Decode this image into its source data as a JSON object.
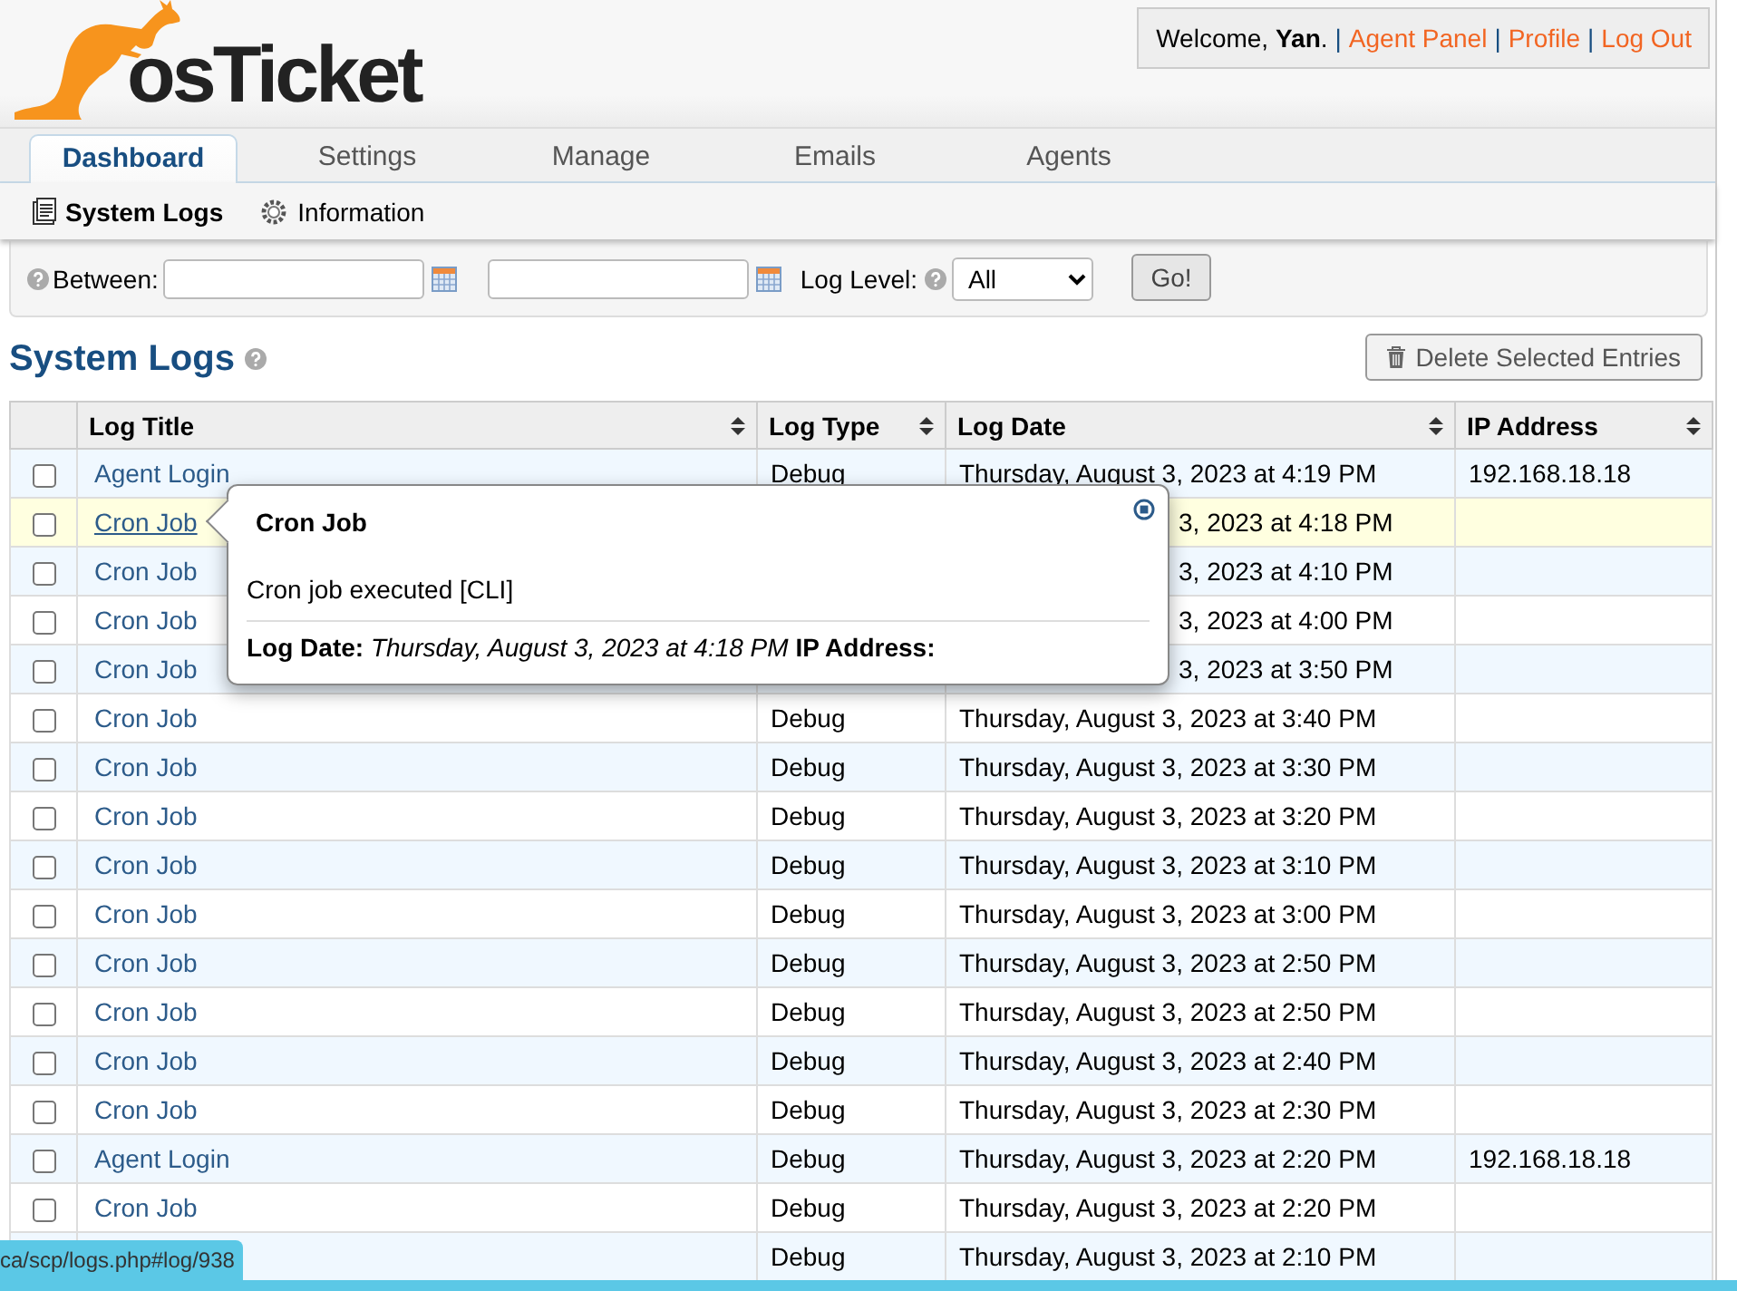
{
  "header": {
    "logo": "osTicket",
    "greeting": "Welcome, **Yan**.",
    "links": [
      {
        "label": "Agent Panel",
        "separator": "|"
      },
      {
        "label": "Profile",
        "separator": "|"
      },
      {
        "label": "Log Out",
        "separator": "|"
      }
    ]
  },
  "nav": {
    "tabs": [
      {
        "label": "Dashboard",
        "selected": true
      },
      {
        "label": "Settings",
        "selected": false
      },
      {
        "label": "Manage",
        "selected": false
      },
      {
        "label": "Emails",
        "selected": false
      },
      {
        "label": "Agents",
        "selected": false
      }
    ],
    "subtabs": [
      {
        "label": "System Logs",
        "kind": "logs",
        "selected": true
      },
      {
        "label": "Information",
        "kind": "info",
        "selected": false
      }
    ]
  },
  "filter": {
    "between_label": "Between:",
    "level_label": "Log Level:",
    "level_value": "All",
    "go_button": "Go!"
  },
  "page_title": "System Logs",
  "delete_button": "Delete Selected Entries",
  "table": {
    "columns": [
      "Log Title",
      "Log Type",
      "Log Date",
      "IP Address"
    ],
    "rows": [
      {
        "checked": false,
        "hovered": false,
        "title": "Agent Login",
        "type": "Debug",
        "date": "Thursday, August 3, 2023 at 4:19 PM",
        "ip": "192.168.18.18"
      },
      {
        "checked": false,
        "hovered": true,
        "title": "Cron Job",
        "date": "3, 2023 at 4:18 PM"
      },
      {
        "checked": false,
        "hovered": false,
        "title": "Cron Job",
        "date": "3, 2023 at 4:10 PM"
      },
      {
        "checked": false,
        "hovered": false,
        "title": "Cron Job",
        "date": "3, 2023 at 4:00 PM"
      },
      {
        "checked": false,
        "hovered": false,
        "title": "Cron Job",
        "date": "3, 2023 at 3:50 PM"
      },
      {
        "checked": false,
        "hovered": false,
        "title": "Cron Job",
        "type": "Debug",
        "date": "Thursday, August 3, 2023 at 3:40 PM"
      },
      {
        "checked": false,
        "hovered": false,
        "title": "Cron Job",
        "type": "Debug",
        "date": "Thursday, August 3, 2023 at 3:30 PM"
      },
      {
        "checked": false,
        "hovered": false,
        "title": "Cron Job",
        "type": "Debug",
        "date": "Thursday, August 3, 2023 at 3:20 PM"
      },
      {
        "checked": false,
        "hovered": false,
        "title": "Cron Job",
        "type": "Debug",
        "date": "Thursday, August 3, 2023 at 3:10 PM"
      },
      {
        "checked": false,
        "hovered": false,
        "title": "Cron Job",
        "type": "Debug",
        "date": "Thursday, August 3, 2023 at 3:00 PM"
      },
      {
        "checked": false,
        "hovered": false,
        "title": "Cron Job",
        "type": "Debug",
        "date": "Thursday, August 3, 2023 at 2:50 PM"
      },
      {
        "checked": false,
        "hovered": false,
        "title": "Cron Job",
        "type": "Debug",
        "date": "Thursday, August 3, 2023 at 2:50 PM"
      },
      {
        "checked": false,
        "hovered": false,
        "title": "Cron Job",
        "type": "Debug",
        "date": "Thursday, August 3, 2023 at 2:40 PM"
      },
      {
        "checked": false,
        "hovered": false,
        "title": "Cron Job",
        "type": "Debug",
        "date": "Thursday, August 3, 2023 at 2:30 PM"
      },
      {
        "checked": false,
        "hovered": false,
        "title": "Agent Login",
        "type": "Debug",
        "date": "Thursday, August 3, 2023 at 2:20 PM",
        "ip": "192.168.18.18"
      },
      {
        "checked": false,
        "hovered": false,
        "title": "Cron Job",
        "type": "Debug",
        "date": "Thursday, August 3, 2023 at 2:20 PM"
      },
      {
        "hovered": false,
        "type": "Debug",
        "date": "Thursday, August 3, 2023 at 2:10 PM"
      }
    ]
  },
  "popup": {
    "title": "Cron Job",
    "body": "Cron job executed [CLI]",
    "footer": "**Log Date:** *Thursday, August 3, 2023 at 4:18 PM* **IP Address:**"
  },
  "status_url": "ca/scp/logs.php#log/938"
}
